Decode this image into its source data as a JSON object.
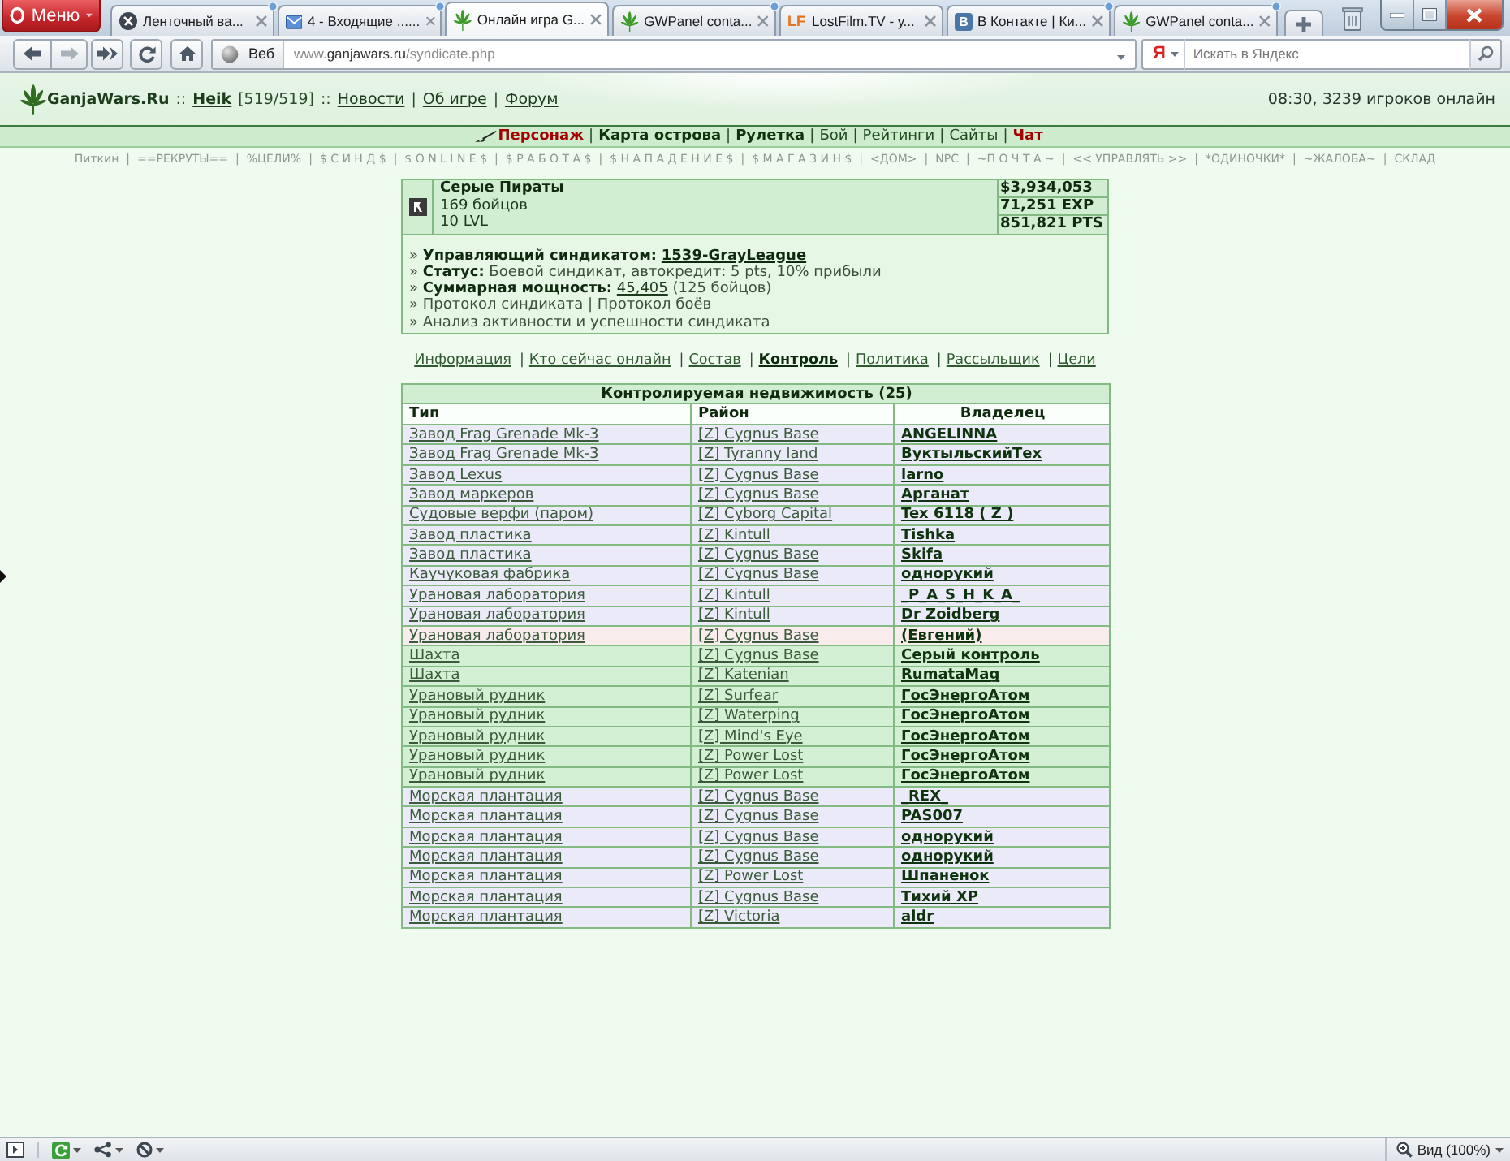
{
  "browser": {
    "menu_label": "Меню",
    "tabs": [
      {
        "title": "Ленточный ва...",
        "kind": "disc",
        "selected": false,
        "updated": true
      },
      {
        "title": "4 - Входящие ......",
        "kind": "mail",
        "selected": false,
        "updated": true
      },
      {
        "title": "Онлайн игра G...",
        "kind": "leaf",
        "selected": true,
        "updated": false
      },
      {
        "title": "GWPanel conta...",
        "kind": "leaf",
        "selected": false,
        "updated": true
      },
      {
        "title": "LostFilm.TV - у...",
        "kind": "letters",
        "mark": "LF",
        "selected": false,
        "updated": false
      },
      {
        "title": "В Контакте | Ки...",
        "kind": "tile",
        "mark": "В",
        "selected": false,
        "updated": true
      },
      {
        "title": "GWPanel conta...",
        "kind": "leaf",
        "selected": false,
        "updated": true
      }
    ]
  },
  "toolbar": {
    "web_label": "Веб",
    "address": "www.**ganjawars.ru**/syndicate.php",
    "search_engine_mark": "Я",
    "search_placeholder": "Искать в Яндекс"
  },
  "header": {
    "logo": "GanjaWars.Ru",
    "separator": "::",
    "user": "Heik",
    "health": "[519/519]",
    "links": [
      "Новости",
      "Об игре",
      "Форум"
    ],
    "link_separator": "|",
    "online": "08:30, 3239 игроков онлайн"
  },
  "nav": {
    "separator": "|",
    "items": [
      {
        "label": "Персонаж",
        "kind": "current"
      },
      {
        "label": "Карта острова",
        "kind": "bold"
      },
      {
        "label": "Рулетка",
        "kind": "bold"
      },
      {
        "label": "Бой",
        "kind": "plain"
      },
      {
        "label": "Рейтинги",
        "kind": "plain"
      },
      {
        "label": "Сайты",
        "kind": "plain"
      },
      {
        "label": "Чат",
        "kind": "alert"
      }
    ]
  },
  "submenu": {
    "separator": "|",
    "items": [
      "Питкин",
      "==РЕКРУТЫ==",
      "%ЦЕЛИ%",
      "$ С И Н Д $",
      "$ O N L I N E $",
      "$ Р А Б О Т А $",
      "$ Н А П А Д Е Н И Е $",
      "$ М А Г А З И Н $",
      "<ДОМ>",
      "NPC",
      "~П О Ч Т А ~",
      "<< УПРАВЛЯТЬ >>",
      "*ОДИНОЧКИ*",
      "~ЖАЛОБА~",
      "СКЛАД"
    ]
  },
  "syndicate": {
    "name": "Серые Пираты",
    "members": "169 бойцов",
    "level": "10 LVL",
    "stats": [
      "$3,934,053",
      "71,251 EXP",
      "851,821 PTS"
    ],
    "bullet": "»",
    "details": [
      {
        "parts": [
          {
            "kind": "label",
            "text": "Управляющий синдикатом:"
          },
          {
            "kind": "strong-link",
            "text": "1539-GrayLeague"
          }
        ]
      },
      {
        "parts": [
          {
            "kind": "label",
            "text": "Статус:"
          },
          {
            "kind": "text",
            "text": "Боевой синдикат, автокредит: 5 pts, 10% прибыли"
          }
        ]
      },
      {
        "parts": [
          {
            "kind": "label",
            "text": "Суммарная мощность:"
          },
          {
            "kind": "link",
            "text": "45,405"
          },
          {
            "kind": "text",
            "text": "(125 бойцов)"
          }
        ]
      },
      {
        "parts": [
          {
            "kind": "text",
            "text": "Протокол синдиката | Протокол боёв"
          }
        ]
      },
      {
        "parts": [
          {
            "kind": "text",
            "text": "Анализ активности и успешности синдиката"
          }
        ]
      }
    ]
  },
  "sections": {
    "separator": "|",
    "items": [
      {
        "label": "Информация",
        "selected": false
      },
      {
        "label": "Кто сейчас онлайн",
        "selected": false
      },
      {
        "label": "Состав",
        "selected": false
      },
      {
        "label": "Контроль",
        "selected": true
      },
      {
        "label": "Политика",
        "selected": false
      },
      {
        "label": "Рассыльщик",
        "selected": false
      },
      {
        "label": "Цели",
        "selected": false
      }
    ]
  },
  "table": {
    "title": "Контролируемая недвижимость (25)",
    "columns": [
      "Тип",
      "Район",
      "Владелец"
    ],
    "rows": [
      {
        "type": "Завод Frag Grenade Mk-3",
        "district": "[Z] Cygnus Base",
        "owner": "ANGELINNA",
        "color": "#eaeaf8"
      },
      {
        "type": "Завод Frag Grenade Mk-3",
        "district": "[Z] Tyranny land",
        "owner": "ВуктыльскийТех",
        "color": "#eaeaf8"
      },
      {
        "type": "Завод Lexus",
        "district": "[Z] Cygnus Base",
        "owner": "larno",
        "color": "#eaeaf8"
      },
      {
        "type": "Завод маркеров",
        "district": "[Z] Cygnus Base",
        "owner": "Арганат",
        "color": "#eaeaf8"
      },
      {
        "type": "Судовые верфи (паром)",
        "district": "[Z] Cyborg Capital",
        "owner": "Tex 6118 ( Z )",
        "color": "#eaeaf8"
      },
      {
        "type": "Завод пластика",
        "district": "[Z] Kintull",
        "owner": "Tishka",
        "color": "#eaeaf8"
      },
      {
        "type": "Завод пластика",
        "district": "[Z] Cygnus Base",
        "owner": "Skifa",
        "color": "#eaeaf8"
      },
      {
        "type": "Каучуковая фабрика",
        "district": "[Z] Cygnus Base",
        "owner": "однорукий",
        "color": "#eaeaf8"
      },
      {
        "type": "Урановая лаборатория",
        "district": "[Z] Kintull",
        "owner": "_P_A_S_H_K_A_",
        "color": "#eaeaf8"
      },
      {
        "type": "Урановая лаборатория",
        "district": "[Z] Kintull",
        "owner": "Dr Zoidberg",
        "color": "#eaeaf8"
      },
      {
        "type": "Урановая лаборатория",
        "district": "[Z] Cygnus Base",
        "owner": "(Евгений)",
        "color": "#f8ecec"
      },
      {
        "type": "Шахта",
        "district": "[Z] Cygnus Base",
        "owner": "Серый контроль",
        "color": "#d4f0d4"
      },
      {
        "type": "Шахта",
        "district": "[Z] Katenian",
        "owner": "RumataMag",
        "color": "#d4f0d4"
      },
      {
        "type": "Урановый рудник",
        "district": "[Z] Surfear",
        "owner": "ГосЭнергоАтом",
        "color": "#d4f0d4"
      },
      {
        "type": "Урановый рудник",
        "district": "[Z] Waterping",
        "owner": "ГосЭнергоАтом",
        "color": "#d4f0d4"
      },
      {
        "type": "Урановый рудник",
        "district": "[Z] Mind's Eye",
        "owner": "ГосЭнергоАтом",
        "color": "#d4f0d4"
      },
      {
        "type": "Урановый рудник",
        "district": "[Z] Power Lost",
        "owner": "ГосЭнергоАтом",
        "color": "#d4f0d4"
      },
      {
        "type": "Урановый рудник",
        "district": "[Z] Power Lost",
        "owner": "ГосЭнергоАтом",
        "color": "#d4f0d4"
      },
      {
        "type": "Морская плантация",
        "district": "[Z] Cygnus Base",
        "owner": "_REX_",
        "color": "#eaeaf8"
      },
      {
        "type": "Морская плантация",
        "district": "[Z] Cygnus Base",
        "owner": "PAS007",
        "color": "#eaeaf8"
      },
      {
        "type": "Морская плантация",
        "district": "[Z] Cygnus Base",
        "owner": "однорукий",
        "color": "#eaeaf8"
      },
      {
        "type": "Морская плантация",
        "district": "[Z] Cygnus Base",
        "owner": "однорукий",
        "color": "#eaeaf8"
      },
      {
        "type": "Морская плантация",
        "district": "[Z] Power Lost",
        "owner": "Шпаненок",
        "color": "#eaeaf8"
      },
      {
        "type": "Морская плантация",
        "district": "[Z] Cygnus Base",
        "owner": "Тихий XP",
        "color": "#eaeaf8"
      },
      {
        "type": "Морская плантация",
        "district": "[Z] Victoria",
        "owner": "aldr",
        "color": "#eaeaf8"
      }
    ]
  },
  "status_bar": {
    "zoom_label": "Вид (100%)"
  }
}
